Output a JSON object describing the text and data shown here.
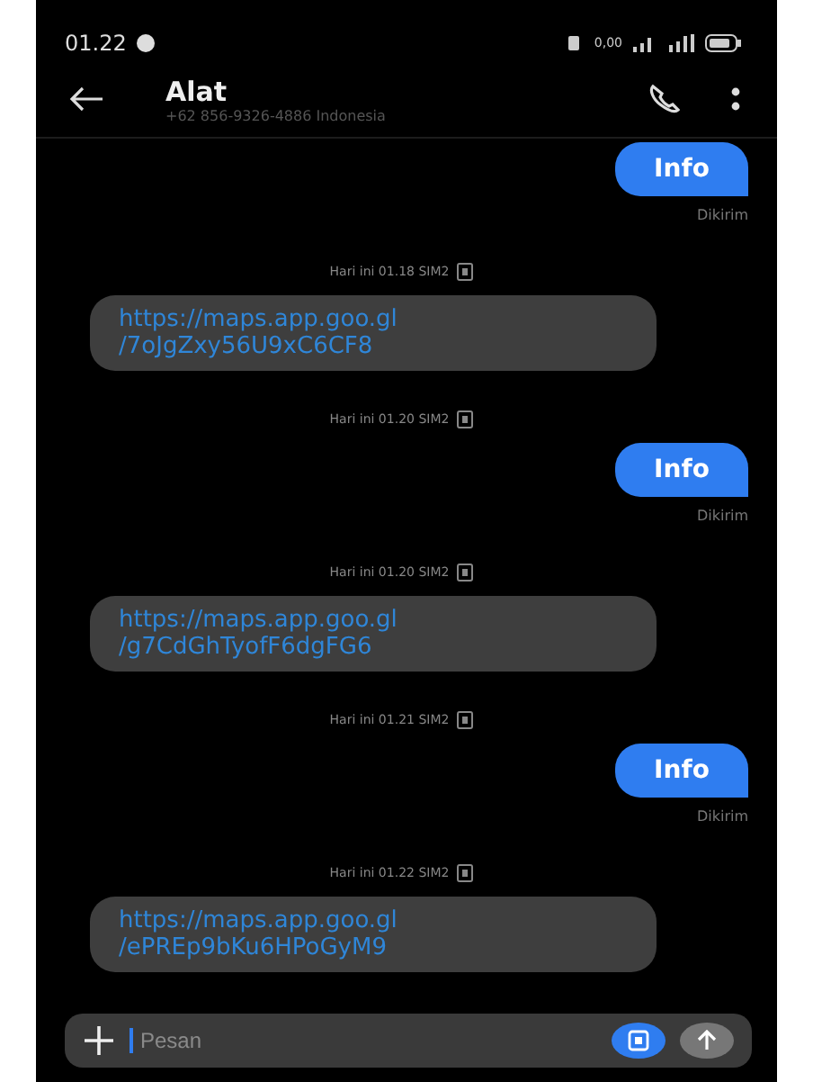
{
  "status_bar": {
    "time": "01.22",
    "network_speed": "0,00"
  },
  "header": {
    "title": "Alat",
    "subtitle": "+62 856-9326-4886  Indonesia"
  },
  "messages": [
    {
      "kind": "sent",
      "text": "Info",
      "status": "Dikirim"
    },
    {
      "kind": "timestamp",
      "text": "Hari ini 01.18  SIM2"
    },
    {
      "kind": "received",
      "lines": [
        "https://maps.app.goo.gl",
        "/7oJgZxy56U9xC6CF8"
      ]
    },
    {
      "kind": "timestamp",
      "text": "Hari ini 01.20  SIM2"
    },
    {
      "kind": "sent",
      "text": "Info",
      "status": "Dikirim"
    },
    {
      "kind": "timestamp",
      "text": "Hari ini 01.20  SIM2"
    },
    {
      "kind": "received",
      "lines": [
        "https://maps.app.goo.gl",
        "/g7CdGhTyofF6dgFG6"
      ]
    },
    {
      "kind": "timestamp",
      "text": "Hari ini 01.21  SIM2"
    },
    {
      "kind": "sent",
      "text": "Info",
      "status": "Dikirim"
    },
    {
      "kind": "timestamp",
      "text": "Hari ini 01.22  SIM2"
    },
    {
      "kind": "received",
      "lines": [
        "https://maps.app.goo.gl",
        "/ePREp9bKu6HPoGyM9"
      ]
    }
  ],
  "composer": {
    "placeholder": "Pesan"
  }
}
